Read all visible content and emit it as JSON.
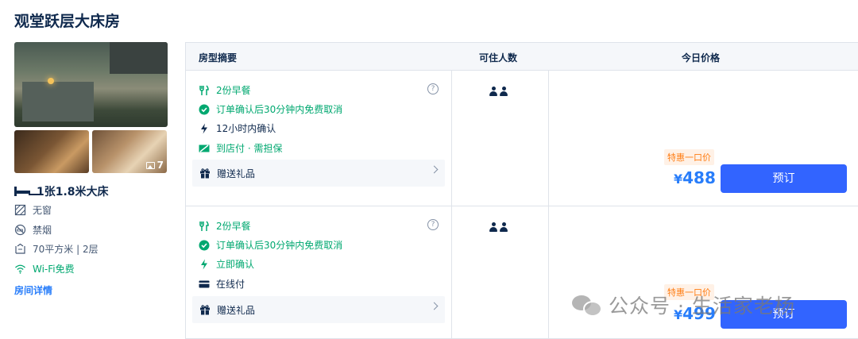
{
  "room": {
    "title": "观堂跃层大床房",
    "photo_count": "7",
    "bed": "1张1.8米大床",
    "features": [
      {
        "icon": "no-window-icon",
        "label": "无窗"
      },
      {
        "icon": "no-smoking-icon",
        "label": "禁烟"
      },
      {
        "icon": "area-icon",
        "label": "70平方米 | 2层"
      },
      {
        "icon": "wifi-icon",
        "label": "Wi-Fi免费"
      }
    ],
    "detail_link": "房间详情"
  },
  "table": {
    "headers": {
      "summary": "房型摘要",
      "occupancy": "可住人数",
      "price": "今日价格"
    },
    "rows": [
      {
        "breakfast": "2份早餐",
        "cancel": "订单确认后30分钟内免费取消",
        "confirm": "12小时内确认",
        "payment": "到店付 · 需担保",
        "gift": "赠送礼品",
        "deal_tag": "特惠一口价",
        "currency": "¥",
        "price": "488",
        "book_label": "预订"
      },
      {
        "breakfast": "2份早餐",
        "cancel": "订单确认后30分钟内免费取消",
        "confirm": "立即确认",
        "payment": "在线付",
        "gift": "赠送礼品",
        "deal_tag": "特惠一口价",
        "currency": "¥",
        "price": "499",
        "book_label": "预订"
      }
    ]
  },
  "watermark": {
    "text": "公众号 · 生活家老杨"
  },
  "colors": {
    "brand_blue": "#3264ff",
    "price_blue": "#287dfa",
    "green": "#00a870",
    "deal_orange": "#ff7d13"
  }
}
